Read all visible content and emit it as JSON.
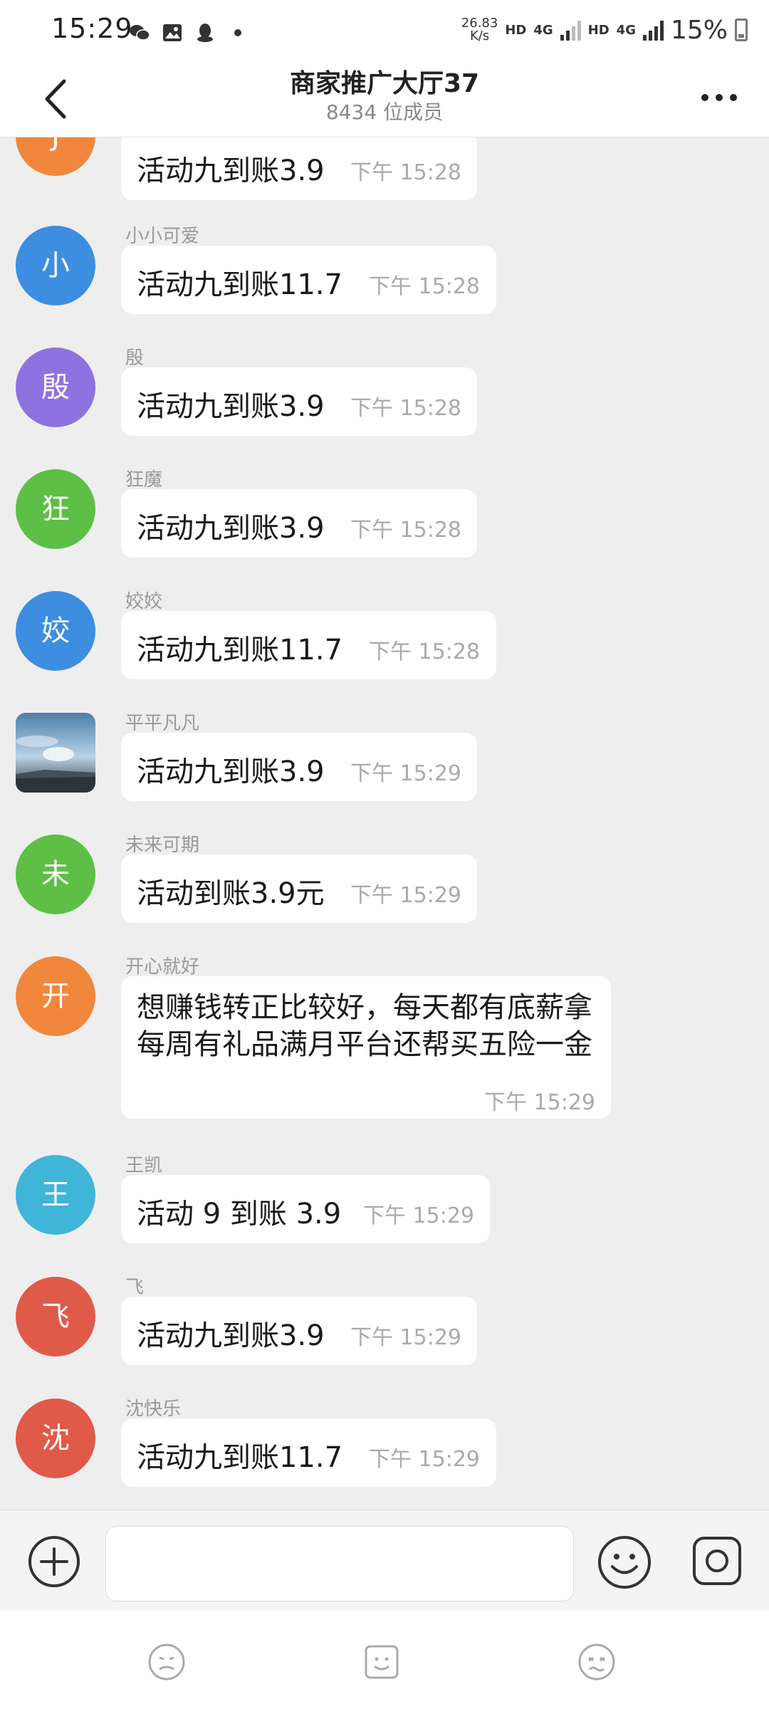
{
  "status": {
    "time": "15:29",
    "speed_value": "26.83",
    "speed_unit": "K/s",
    "hd1": "HD",
    "net1": "4G",
    "hd2": "HD",
    "net2": "4G",
    "battery": "15%",
    "icons": [
      "wechat-icon",
      "gallery-icon",
      "qq-icon",
      "dot-icon"
    ]
  },
  "header": {
    "title": "商家推广大厅37",
    "subtitle": "8434 位成员"
  },
  "messages": [
    {
      "sender": "",
      "avatar_text": "J",
      "avatar_color": "#f0873d",
      "text": "活动九到账3.9",
      "time": "下午 15:28"
    },
    {
      "sender": "小小可爱",
      "avatar_text": "小",
      "avatar_color": "#3d8ee0",
      "text": "活动九到账11.7",
      "time": "下午 15:28"
    },
    {
      "sender": "殷",
      "avatar_text": "殷",
      "avatar_color": "#8d73e0",
      "text": "活动九到账3.9",
      "time": "下午 15:28"
    },
    {
      "sender": "狂魔",
      "avatar_text": "狂",
      "avatar_color": "#5dbf45",
      "text": "活动九到账3.9",
      "time": "下午 15:28"
    },
    {
      "sender": "姣姣",
      "avatar_text": "姣",
      "avatar_color": "#3d8ee0",
      "text": "活动九到账11.7",
      "time": "下午 15:28"
    },
    {
      "sender": "平平凡凡",
      "avatar_text": "",
      "avatar_color": "#5a7fa0",
      "text": "活动九到账3.9",
      "time": "下午 15:29"
    },
    {
      "sender": "未来可期",
      "avatar_text": "未",
      "avatar_color": "#5dbf45",
      "text": "活动到账3.9元",
      "time": "下午 15:29"
    },
    {
      "sender": "开心就好",
      "avatar_text": "开",
      "avatar_color": "#f0873d",
      "text": "想赚钱转正比较好，每天都有底薪拿每周有礼品满月平台还帮买五险一金",
      "time": "下午 15:29"
    },
    {
      "sender": "王凯",
      "avatar_text": "王",
      "avatar_color": "#3fb5d8",
      "text": "活动 9 到账 3.9",
      "time": "下午 15:29"
    },
    {
      "sender": "飞",
      "avatar_text": "飞",
      "avatar_color": "#e05a4a",
      "text": "活动九到账3.9",
      "time": "下午 15:29"
    },
    {
      "sender": "沈快乐",
      "avatar_text": "沈",
      "avatar_color": "#e05a4a",
      "text": "活动九到账11.7",
      "time": "下午 15:29"
    }
  ],
  "input": {
    "placeholder": ""
  }
}
